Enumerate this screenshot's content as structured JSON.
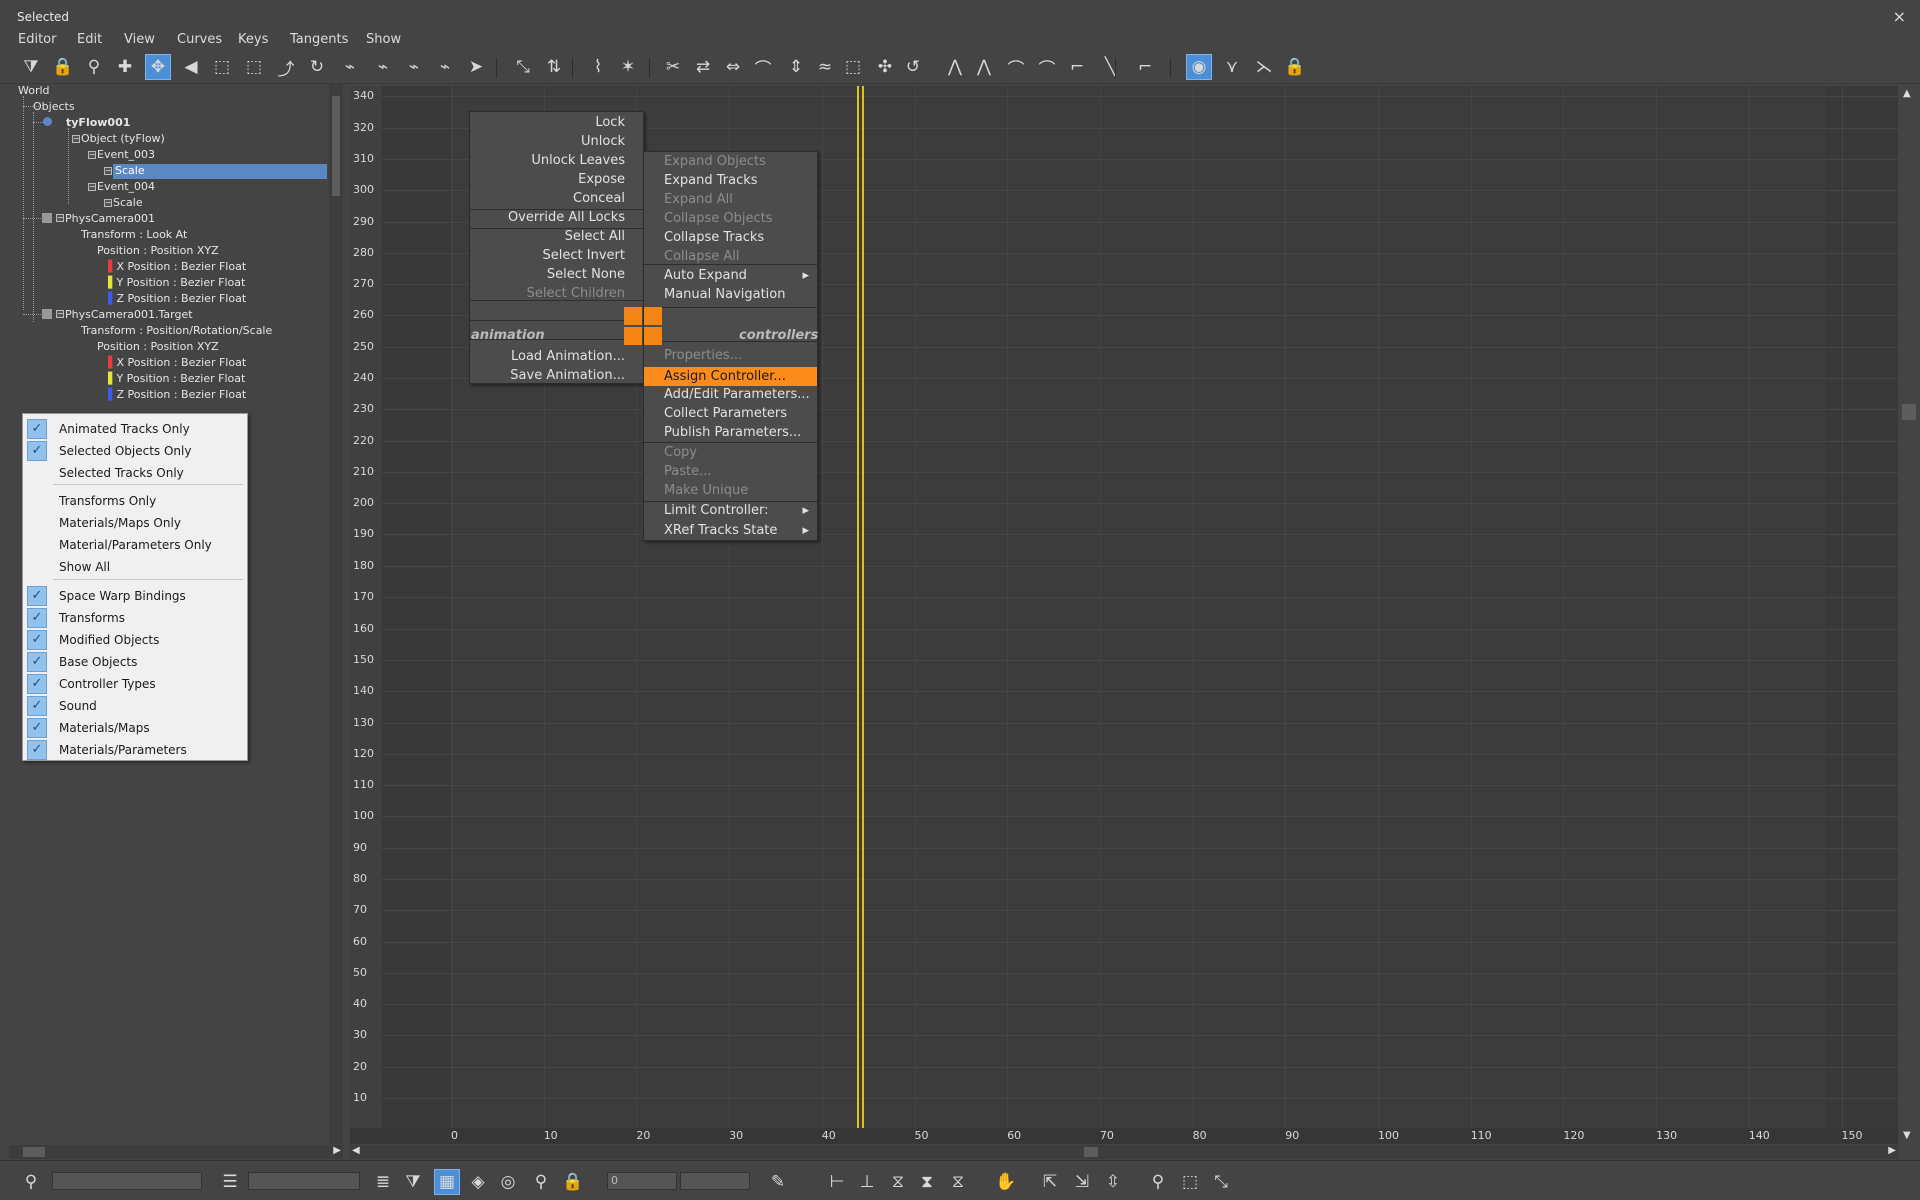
{
  "window": {
    "title": "Selected",
    "close_glyph": "×"
  },
  "menubar": [
    "Editor",
    "Edit",
    "View",
    "Curves",
    "Keys",
    "Tangents",
    "Show"
  ],
  "toolbar_icons": [
    "filter-icon",
    "lock-icon",
    "snap-icon",
    "add-key-icon",
    "move-keys-icon",
    "slide-keys-icon",
    "scale-keys-icon",
    "scale-values-icon",
    "ease-curve-icon",
    "multiplier-curve-icon",
    "param-curve-icon",
    "curve-out-icon",
    "curve-in-icon",
    "curve-arrow-icon",
    "select-arrow-icon",
    "reduce-keys-icon",
    "move-keys-vertical-icon",
    "simplify-icon",
    "break-tangents-icon",
    "unify-tangents-icon",
    "flatten-icon",
    "fit-icon",
    "keys-icon",
    "smooth-icon",
    "ease-icon",
    "trajectory-icon",
    "snap-time-icon",
    "loop-icon",
    "auto-tangent-icon",
    "spline-tangent-icon",
    "fast-tangent-icon",
    "slow-tangent-icon",
    "step-tangent-icon",
    "linear-tangent-icon",
    "smooth-tangent-icon",
    "show-tangents-icon",
    "lock-tangents-icon",
    "show-all-tangents-icon",
    "lock-selection-icon"
  ],
  "tree": {
    "world": "World",
    "objects": "Objects",
    "tyflow": "tyFlow001",
    "object_tyflow": "Object (tyFlow)",
    "event3": "Event_003",
    "scale1": "Scale",
    "event4": "Event_004",
    "scale2": "Scale",
    "cam": "PhysCamera001",
    "cam_transform": "Transform : Look At",
    "cam_position": "Position : Position XYZ",
    "cam_x": "X Position : Bezier Float",
    "cam_y": "Y Position : Bezier Float",
    "cam_z": "Z Position : Bezier Float",
    "target": "PhysCamera001.Target",
    "target_transform": "Transform : Position/Rotation/Scale",
    "target_position": "Position : Position XYZ",
    "target_x": "X Position : Bezier Float",
    "target_y": "Y Position : Bezier Float",
    "target_z": "Z Position : Bezier Float"
  },
  "filter_menu": [
    {
      "label": "Animated Tracks Only",
      "checked": true
    },
    {
      "label": "Selected Objects Only",
      "checked": true
    },
    {
      "label": "Selected Tracks Only",
      "checked": false
    },
    {
      "label": "Transforms Only",
      "checked": false
    },
    {
      "label": "Materials/Maps Only",
      "checked": false
    },
    {
      "label": "Material/Parameters Only",
      "checked": false
    },
    {
      "label": "Show All",
      "checked": false
    },
    {
      "label": "Space Warp Bindings",
      "checked": true
    },
    {
      "label": "Transforms",
      "checked": true
    },
    {
      "label": "Modified Objects",
      "checked": true
    },
    {
      "label": "Base Objects",
      "checked": true
    },
    {
      "label": "Controller Types",
      "checked": true
    },
    {
      "label": "Sound",
      "checked": true
    },
    {
      "label": "Materials/Maps",
      "checked": true
    },
    {
      "label": "Materials/Parameters",
      "checked": true
    }
  ],
  "check_glyph": "✓",
  "quad_menu": {
    "animation_label": "animation",
    "controllers_label": "controllers",
    "left_top": [
      {
        "label": "Lock",
        "dim": false
      },
      {
        "label": "Unlock",
        "dim": false
      },
      {
        "label": "Unlock Leaves",
        "dim": false
      },
      {
        "label": "Expose",
        "dim": false
      },
      {
        "label": "Conceal",
        "dim": false
      },
      {
        "label": "Override All Locks",
        "dim": false
      },
      {
        "label": "Select All",
        "dim": false
      },
      {
        "label": "Select Invert",
        "dim": false
      },
      {
        "label": "Select None",
        "dim": false
      },
      {
        "label": "Select Children",
        "dim": true
      }
    ],
    "left_bottom": [
      {
        "label": "Load Animation...",
        "dim": false
      },
      {
        "label": "Save Animation...",
        "dim": false
      }
    ],
    "right_top": [
      {
        "label": "Expand Objects",
        "dim": true
      },
      {
        "label": "Expand Tracks",
        "dim": false
      },
      {
        "label": "Expand All",
        "dim": true
      },
      {
        "label": "Collapse Objects",
        "dim": true
      },
      {
        "label": "Collapse Tracks",
        "dim": false
      },
      {
        "label": "Collapse All",
        "dim": true
      },
      {
        "label": "Auto Expand",
        "dim": false,
        "submenu": true
      },
      {
        "label": "Manual Navigation",
        "dim": false
      }
    ],
    "right_bottom": [
      {
        "label": "Properties...",
        "dim": true
      },
      {
        "label": "Assign Controller...",
        "dim": false,
        "highlight": true
      },
      {
        "label": "Add/Edit Parameters...",
        "dim": false
      },
      {
        "label": "Collect Parameters",
        "dim": false
      },
      {
        "label": "Publish Parameters...",
        "dim": false
      },
      {
        "label": "Copy",
        "dim": true
      },
      {
        "label": "Paste...",
        "dim": true
      },
      {
        "label": "Make Unique",
        "dim": true
      },
      {
        "label": "Limit Controller:",
        "dim": false,
        "submenu": true
      },
      {
        "label": "XRef Tracks State",
        "dim": false,
        "submenu": true
      }
    ],
    "submenu_glyph": "▸"
  },
  "graph": {
    "y_labels": [
      "340",
      "320",
      "310",
      "300",
      "290",
      "280",
      "270",
      "260",
      "250",
      "240",
      "230",
      "220",
      "210",
      "200",
      "190",
      "180",
      "170",
      "160",
      "150",
      "140",
      "130",
      "120",
      "110",
      "100",
      "90",
      "80",
      "70",
      "60",
      "50",
      "40",
      "30",
      "20",
      "10"
    ],
    "x_labels": [
      "0",
      "10",
      "20",
      "30",
      "40",
      "50",
      "60",
      "70",
      "80",
      "90",
      "100",
      "110",
      "120",
      "130",
      "140",
      "150"
    ],
    "current_frame": 44
  },
  "bottombar": {
    "field1": "",
    "field2": "0",
    "field3": "",
    "icons_left": [
      "zoom-region-icon"
    ],
    "icons_mid": [
      "filter-list-icon",
      "show-selected-key-stats-icon",
      "filter-tracks-icon",
      "key-mode-icon",
      "layer-icon",
      "isolate-icon",
      "key-search-icon",
      "lock-current-selection-icon"
    ],
    "icons_right": [
      "parameter-collector-icon",
      "frame-horizontal-icon",
      "frame-value-icon",
      "frame-horizontal-extents-icon",
      "frame-values-extents-icon",
      "frame-vertical-icon",
      "pan-icon",
      "zoom-horizontal-icon",
      "zoom-values-icon",
      "zoom-time-icon",
      "zoom-icon",
      "zoom-region2-icon",
      "isolate-curve-icon"
    ]
  }
}
